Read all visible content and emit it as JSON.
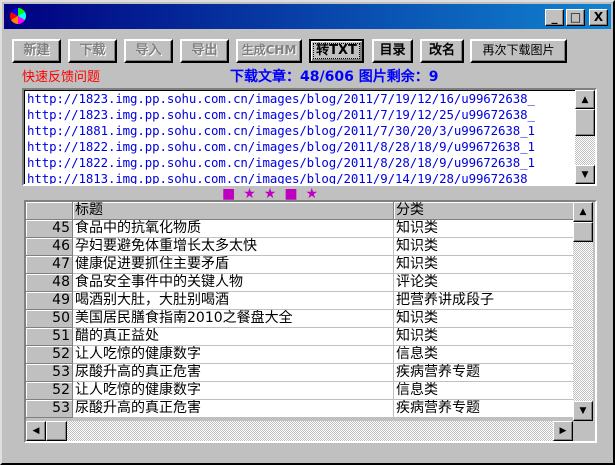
{
  "window": {
    "controls": [
      "_",
      "□",
      "X"
    ]
  },
  "toolbar": {
    "buttons": [
      {
        "label": "新建",
        "enabled": false
      },
      {
        "label": "下载",
        "enabled": false
      },
      {
        "label": "导入",
        "enabled": false
      },
      {
        "label": "导出",
        "enabled": false
      },
      {
        "label": "生成CHM",
        "enabled": false
      },
      {
        "label": "转TXT",
        "enabled": true
      },
      {
        "label": "目录",
        "enabled": true
      },
      {
        "label": "改名",
        "enabled": true
      },
      {
        "label": "再次下载图片",
        "enabled": true
      }
    ]
  },
  "feedback_link": "快速反馈问题",
  "status": "下载文章：48/606  图片剩余：9",
  "url_list": [
    "http://1823.img.pp.sohu.com.cn/images/blog/2011/7/19/12/16/u99672638_",
    "http://1823.img.pp.sohu.com.cn/images/blog/2011/7/19/12/25/u99672638_",
    "http://1881.img.pp.sohu.com.cn/images/blog/2011/7/30/20/3/u99672638_1",
    "http://1822.img.pp.sohu.com.cn/images/blog/2011/8/28/18/9/u99672638_1",
    "http://1822.img.pp.sohu.com.cn/images/blog/2011/8/28/18/9/u99672638_1",
    "http://1813.img.pp.sohu.com.cn/images/blog/2011/9/14/19/28/u99672638_"
  ],
  "progress_marks": "■★★■★",
  "colors": {
    "status": "#0000ff",
    "feedback": "#ff0000",
    "marks": "#c000c0",
    "urls": "#0000e0"
  },
  "grid": {
    "headers": {
      "title": "标题",
      "category": "分类"
    },
    "rows": [
      {
        "n": "45",
        "title": "食品中的抗氧化物质",
        "category": "知识类"
      },
      {
        "n": "46",
        "title": "孕妇要避免体重增长太多太快",
        "category": "知识类"
      },
      {
        "n": "47",
        "title": "健康促进要抓住主要矛盾",
        "category": "知识类"
      },
      {
        "n": "48",
        "title": "食品安全事件中的关键人物",
        "category": "评论类"
      },
      {
        "n": "49",
        "title": "喝酒别大肚，大肚别喝酒",
        "category": "把营养讲成段子"
      },
      {
        "n": "50",
        "title": "美国居民膳食指南2010之餐盘大全",
        "category": "知识类"
      },
      {
        "n": "51",
        "title": "醋的真正益处",
        "category": "知识类"
      },
      {
        "n": "52",
        "title": "让人吃惊的健康数字",
        "category": "信息类"
      },
      {
        "n": "53",
        "title": "尿酸升高的真正危害",
        "category": "疾病营养专题"
      },
      {
        "n": "52",
        "title": "让人吃惊的健康数字",
        "category": "信息类"
      },
      {
        "n": "53",
        "title": "尿酸升高的真正危害",
        "category": "疾病营养专题"
      }
    ]
  }
}
